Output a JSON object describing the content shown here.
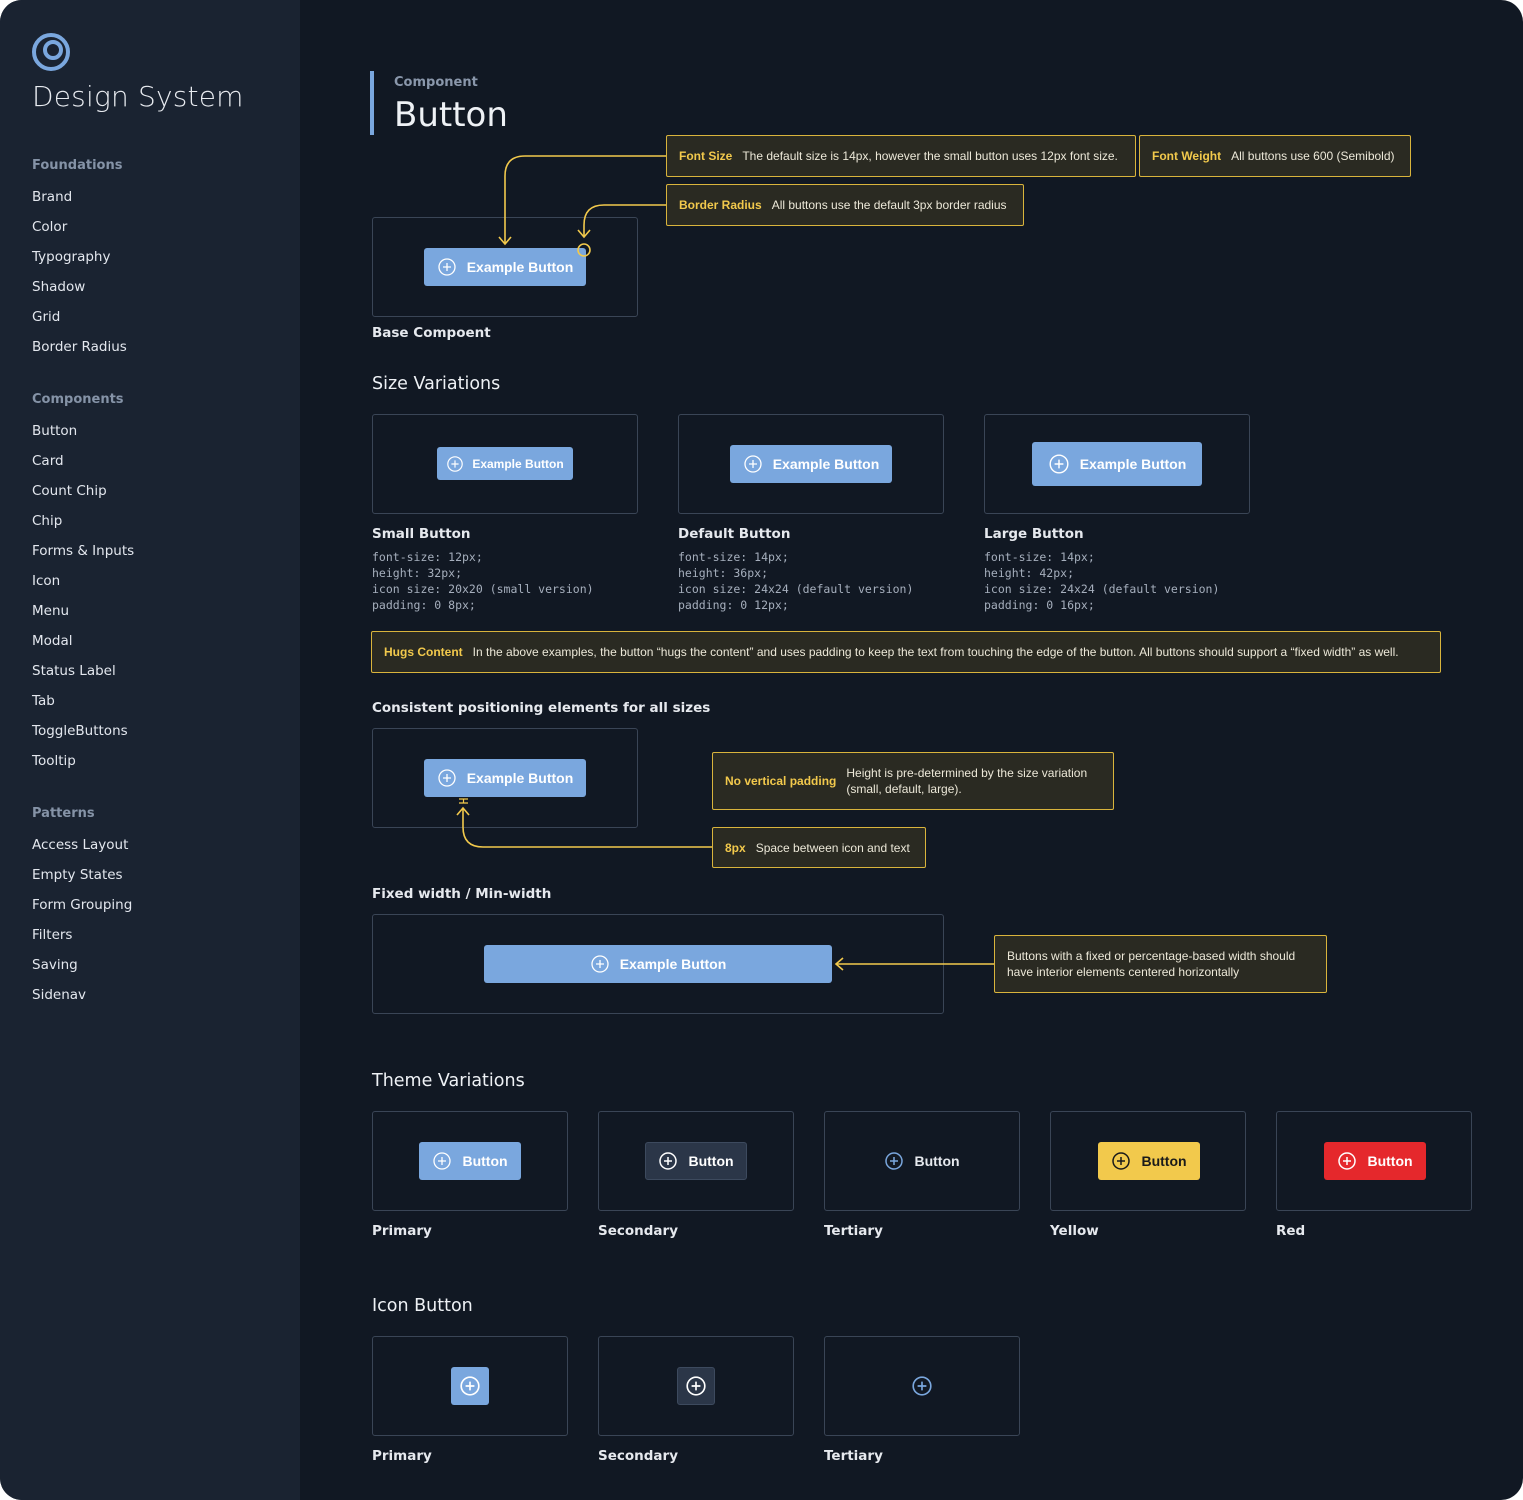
{
  "sidebar": {
    "title": "Design System",
    "groups": [
      {
        "heading": "Foundations",
        "items": [
          "Brand",
          "Color",
          "Typography",
          "Shadow",
          "Grid",
          "Border Radius"
        ]
      },
      {
        "heading": "Components",
        "items": [
          "Button",
          "Card",
          "Count Chip",
          "Chip",
          "Forms & Inputs",
          "Icon",
          "Menu",
          "Modal",
          "Status Label",
          "Tab",
          "ToggleButtons",
          "Tooltip"
        ]
      },
      {
        "heading": "Patterns",
        "items": [
          "Access Layout",
          "Empty States",
          "Form Grouping",
          "Filters",
          "Saving",
          "Sidenav"
        ]
      }
    ]
  },
  "header": {
    "eyebrow": "Component",
    "title": "Button"
  },
  "base": {
    "button_label": "Example Button",
    "caption": "Base Compoent",
    "notes": {
      "font_size": {
        "key": "Font Size",
        "text": "The default size is 14px, however the small button uses 12px font size."
      },
      "font_weight": {
        "key": "Font Weight",
        "text": "All buttons use 600 (Semibold)"
      },
      "border_radius": {
        "key": "Border Radius",
        "text": "All buttons use the default 3px border radius"
      }
    }
  },
  "sizes": {
    "heading": "Size Variations",
    "items": [
      {
        "label": "Small Button",
        "button_label": "Example Button",
        "specs": [
          "font-size: 12px;",
          "height: 32px;",
          "icon size: 20x20 (small version)",
          "padding: 0 8px;"
        ]
      },
      {
        "label": "Default Button",
        "button_label": "Example Button",
        "specs": [
          "font-size: 14px;",
          "height: 36px;",
          "icon size: 24x24 (default version)",
          "padding: 0 12px;"
        ]
      },
      {
        "label": "Large Button",
        "button_label": "Example Button",
        "specs": [
          "font-size: 14px;",
          "height: 42px;",
          "icon size: 24x24 (default version)",
          "padding: 0 16px;"
        ]
      }
    ],
    "hugs_note": {
      "key": "Hugs Content",
      "text": "In the above examples, the button “hugs the content” and uses padding to keep the text from touching the edge of the button. All buttons should support a “fixed width” as well."
    }
  },
  "positioning": {
    "heading": "Consistent positioning elements for all sizes",
    "button_label": "Example Button",
    "no_padding_note": {
      "key": "No vertical padding",
      "text": "Height is pre-determined by the size variation (small, default, large)."
    },
    "gap_note": {
      "key": "8px",
      "text": "Space between icon and text"
    }
  },
  "fixed": {
    "heading": "Fixed width / Min-width",
    "button_label": "Example Button",
    "note": "Buttons with a fixed or percentage-based width should have interior elements centered horizontally"
  },
  "themes": {
    "heading": "Theme Variations",
    "items": [
      {
        "label": "Primary",
        "button_label": "Button"
      },
      {
        "label": "Secondary",
        "button_label": "Button"
      },
      {
        "label": "Tertiary",
        "button_label": "Button"
      },
      {
        "label": "Yellow",
        "button_label": "Button"
      },
      {
        "label": "Red",
        "button_label": "Button"
      }
    ]
  },
  "icon_buttons": {
    "heading": "Icon Button",
    "items": [
      {
        "label": "Primary"
      },
      {
        "label": "Secondary"
      },
      {
        "label": "Tertiary"
      }
    ]
  },
  "colors": {
    "background": "#111823",
    "sidebar": "#1a2331",
    "primary": "#7aa7de",
    "secondary": "#2b3648",
    "yellow": "#f2c94c",
    "red": "#e5282c",
    "annotation": "#f2c94c"
  },
  "icons": {
    "logo": "ring-logo-icon",
    "button": "plus-circle-icon"
  }
}
